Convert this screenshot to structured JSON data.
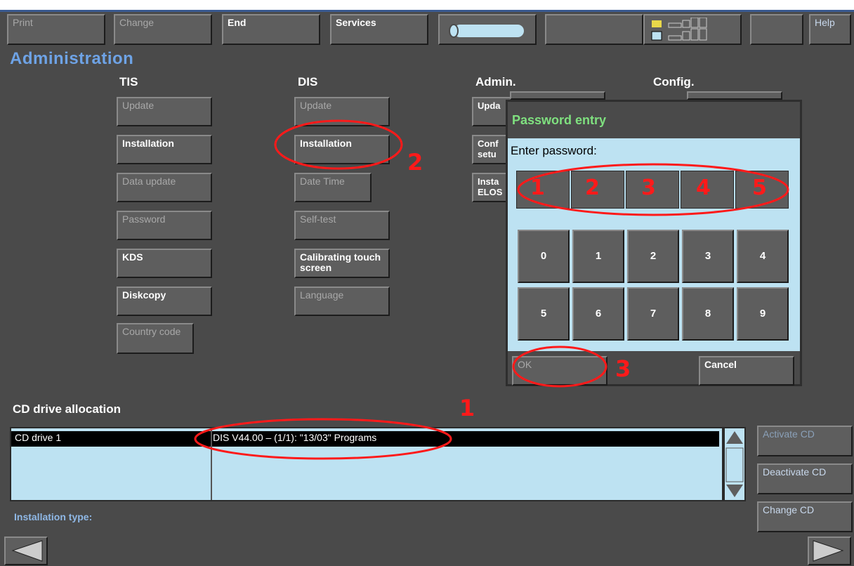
{
  "toolbar": {
    "print": "Print",
    "change": "Change",
    "end": "End",
    "services": "Services",
    "help": "Help"
  },
  "page_title": "Administration",
  "columns": {
    "tis": "TIS",
    "dis": "DIS",
    "admin": "Admin.",
    "config": "Config."
  },
  "tis_buttons": [
    "Update",
    "Installation",
    "Data update",
    "Password",
    "KDS",
    "Diskcopy",
    "Country code"
  ],
  "dis_buttons": [
    "Update",
    "Installation",
    "Date Time",
    "Self-test",
    "Calibrating touch screen",
    "Language"
  ],
  "admin_buttons": [
    "Upda",
    "Conf setu",
    "Insta ELOS"
  ],
  "dialog": {
    "title": "Password entry",
    "prompt": "Enter password:",
    "keys": [
      "0",
      "1",
      "2",
      "3",
      "4",
      "5",
      "6",
      "7",
      "8",
      "9"
    ],
    "ok": "OK",
    "cancel": "Cancel"
  },
  "cd": {
    "section_title": "CD drive allocation",
    "drive": "CD drive 1",
    "entry": "DIS V44.00  – (1/1): \"13/03\" Programs",
    "activate": "Activate CD",
    "deactivate": "Deactivate CD",
    "change": "Change CD"
  },
  "installation_type_label": "Installation type:",
  "annotations": {
    "n1": "1",
    "n2": "2",
    "n3": "3",
    "pw_digits": [
      "1",
      "2",
      "3",
      "4",
      "5"
    ]
  },
  "colors": {
    "background": "#4a4a4a",
    "title_blue": "#6ea3e6",
    "dialog_bg": "#bde2f2",
    "dialog_title_green": "#7fe07f",
    "annotation_red": "#ff1a1a"
  }
}
